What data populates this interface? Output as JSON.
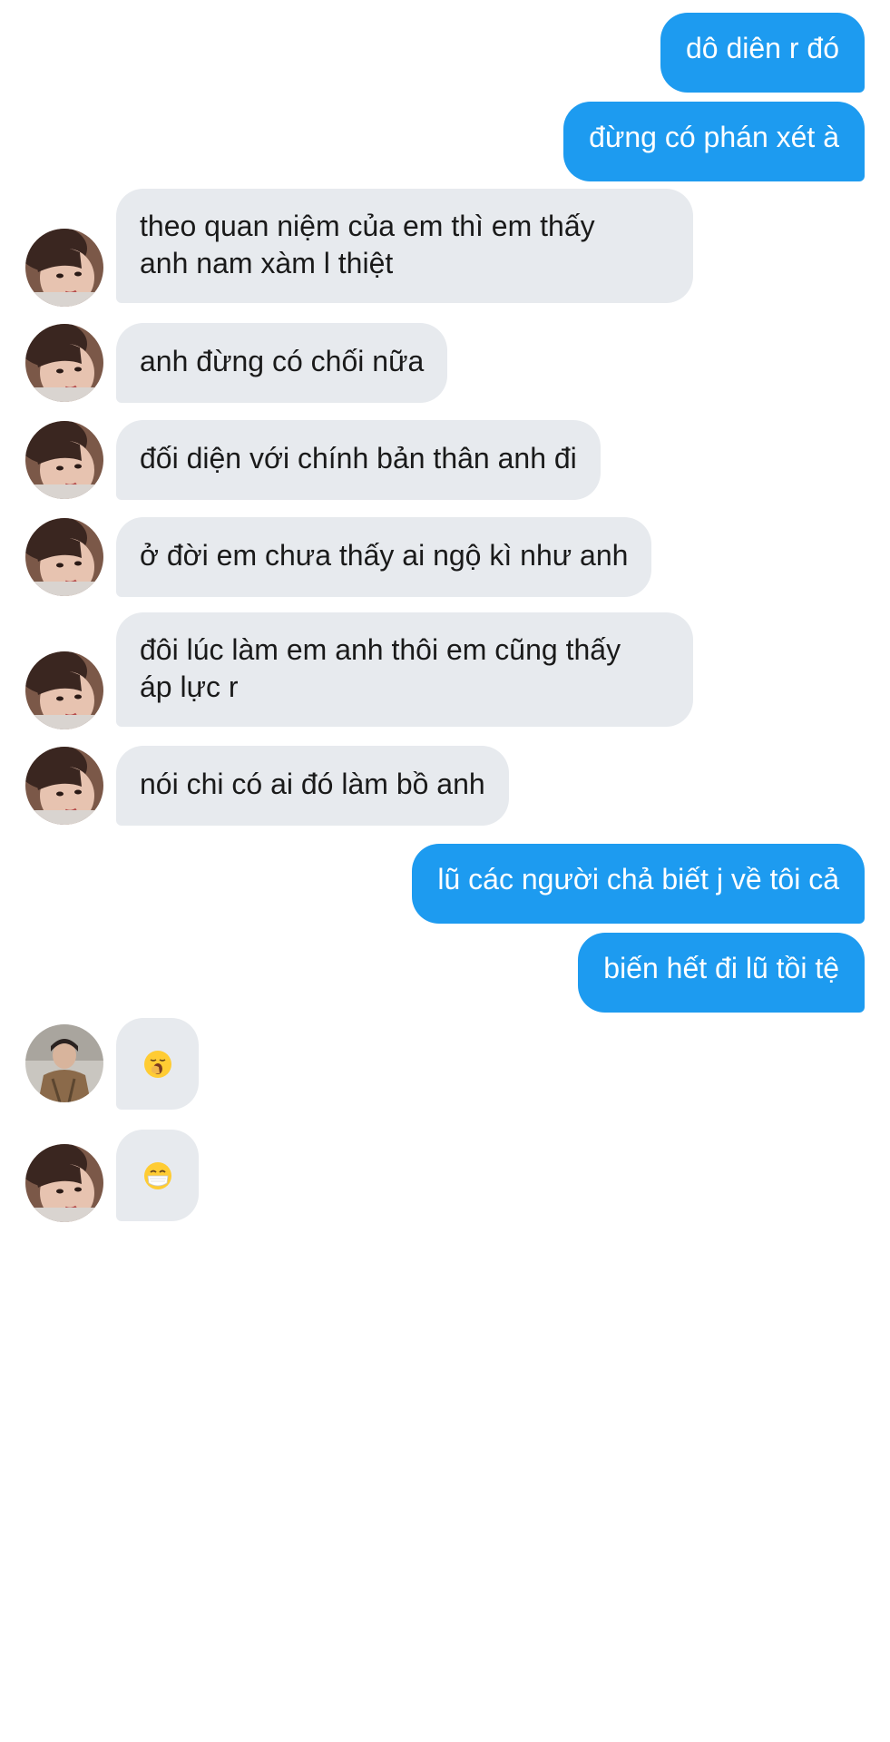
{
  "conversation": {
    "messages": [
      {
        "direction": "outgoing",
        "text": "dô diên r đó"
      },
      {
        "direction": "outgoing",
        "text": "đừng có phán xét à"
      },
      {
        "direction": "incoming",
        "sender": "contact",
        "lines": [
          "theo quan niệm của em thì em thấy",
          "anh nam xàm l thiệt"
        ]
      },
      {
        "direction": "incoming",
        "sender": "contact",
        "text": "anh đừng có chối nữa"
      },
      {
        "direction": "incoming",
        "sender": "contact",
        "text": "đối diện với chính bản thân anh đi"
      },
      {
        "direction": "incoming",
        "sender": "contact",
        "text": "ở đời em chưa thấy ai ngộ kì như anh"
      },
      {
        "direction": "incoming",
        "sender": "contact",
        "lines": [
          "đôi lúc làm em anh thôi em cũng thấy",
          "áp lực r"
        ]
      },
      {
        "direction": "incoming",
        "sender": "contact",
        "text": "nói chi có ai đó làm bồ anh"
      },
      {
        "direction": "outgoing",
        "text": "lũ các người chả biết j về tôi cả"
      },
      {
        "direction": "outgoing",
        "text": "biến hết đi lũ tồi tệ"
      },
      {
        "direction": "incoming",
        "sender": "other-participant",
        "emoji": "yawning-face"
      },
      {
        "direction": "incoming",
        "sender": "contact",
        "emoji": "face-with-medical-mask"
      }
    ]
  },
  "colors": {
    "outgoing_bubble": "#1d9bf0",
    "incoming_bubble": "#e7eaee",
    "background": "#ffffff"
  }
}
